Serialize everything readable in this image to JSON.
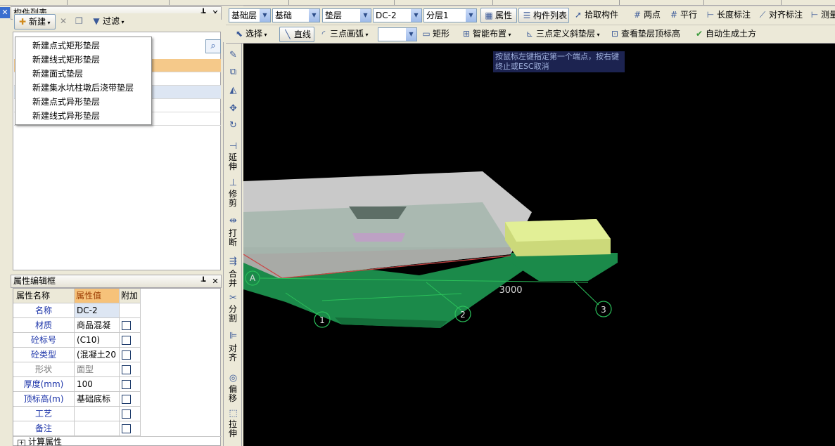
{
  "top_strip": {
    "visible": true
  },
  "component_panel": {
    "title": "构件列表",
    "new_button": "新建",
    "filter_button": "过滤",
    "new_menu": [
      "新建点式矩形垫层",
      "新建线式矩形垫层",
      "新建面式垫层",
      "新建集水坑柱墩后浇带垫层",
      "新建点式异形垫层",
      "新建线式异形垫层"
    ]
  },
  "property_panel": {
    "title": "属性编辑框",
    "columns": [
      "属性名称",
      "属性值",
      "附加"
    ],
    "rows": [
      {
        "name": "名称",
        "value": "DC-2",
        "check": false,
        "gray": false
      },
      {
        "name": "材质",
        "value": "商品混凝",
        "check": true,
        "gray": false
      },
      {
        "name": "砼标号",
        "value": "(C10)",
        "check": true,
        "gray": false
      },
      {
        "name": "砼类型",
        "value": "(混凝土20",
        "check": true,
        "gray": false
      },
      {
        "name": "形状",
        "value": "面型",
        "check": true,
        "gray": true
      },
      {
        "name": "厚度(mm)",
        "value": "100",
        "check": true,
        "gray": false
      },
      {
        "name": "顶标高(m)",
        "value": "基础底标",
        "check": true,
        "gray": false
      },
      {
        "name": "工艺",
        "value": "",
        "check": true,
        "gray": false
      },
      {
        "name": "备注",
        "value": "",
        "check": true,
        "gray": false
      }
    ],
    "calc_group": "计算属性"
  },
  "toolbar_row1": {
    "floor": "基础层",
    "category": "基础",
    "type": "垫层",
    "component": "DC-2",
    "layer": "分层1",
    "properties_btn": "属性",
    "component_list_btn": "构件列表",
    "pick_btn": "拾取构件",
    "two_points_btn": "两点",
    "parallel_btn": "平行",
    "length_dim_btn": "长度标注",
    "align_dim_btn": "对齐标注",
    "measure_btn": "测量"
  },
  "toolbar_row2": {
    "select_btn": "选择",
    "line_btn": "直线",
    "arc_btn": "三点画弧",
    "rect_btn": "矩形",
    "smart_place_btn": "智能布置",
    "slope_btn": "三点定义斜垫层",
    "view_top_btn": "查看垫层顶标高",
    "auto_earth_btn": "自动生成土方"
  },
  "vertical_tools": [
    "延伸",
    "修剪",
    "打断",
    "合并",
    "分割",
    "对齐",
    "偏移",
    "拉伸"
  ],
  "canvas": {
    "hint": "按鼠标左键指定第一个端点，按右键终止或ESC取消",
    "dimension": "3000",
    "axis_labels": [
      "A",
      "1",
      "2",
      "3"
    ]
  },
  "colors": {
    "canvas_bg": "#000000",
    "slab_gray": "#c9c9c9",
    "pad_green": "#1b8a4a",
    "block_yellow": "#ccd97a"
  }
}
